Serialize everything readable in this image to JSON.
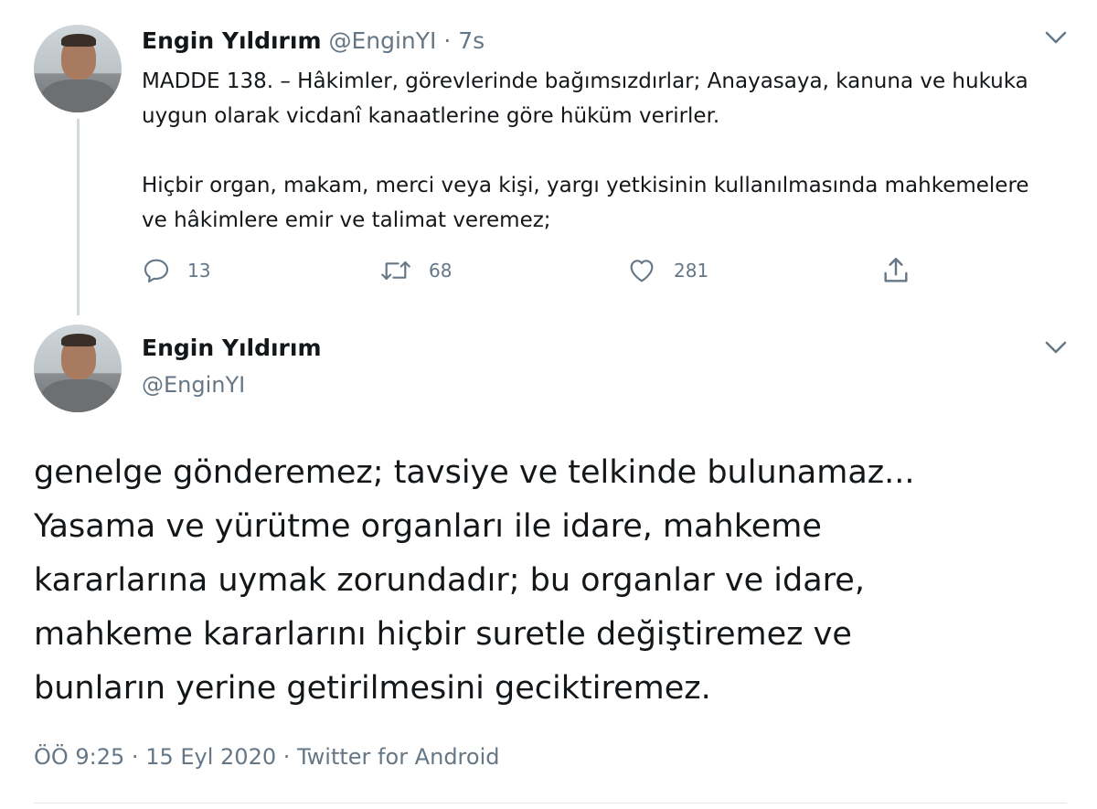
{
  "tweet1": {
    "name": "Engin Yıldırım",
    "handle": "@EnginYI",
    "separator": "·",
    "time": "7s",
    "paragraphs": [
      "MADDE 138. – Hâkimler, görevlerinde bağımsızdırlar; Anayasaya, kanuna ve hukuka uygun olarak vicdanî kanaatlerine göre hüküm verirler.",
      "Hiçbir organ, makam, merci veya kişi, yargı yetkisinin kullanılmasında mahkemelere ve hâkimlere emir ve talimat veremez;"
    ],
    "actions": {
      "reply_count": "13",
      "retweet_count": "68",
      "like_count": "281"
    }
  },
  "tweet2": {
    "name": "Engin Yıldırım",
    "handle": "@EnginYI",
    "lines": [
      "genelge gönderemez; tavsiye ve telkinde bulunamaz...",
      "Yasama ve yürütme organları ile idare, mahkeme",
      "kararlarına uymak zorundadır; bu organlar ve idare,",
      "mahkeme kararlarını hiçbir suretle değiştiremez ve",
      "bunların yerine getirilmesini geciktiremez."
    ],
    "meta": "ÖÖ 9:25 · 15 Eyl 2020 · Twitter for Android"
  },
  "icons": {
    "caret": "chevron-down-icon",
    "reply": "reply-icon",
    "retweet": "retweet-icon",
    "like": "heart-icon",
    "share": "share-icon"
  },
  "colors": {
    "text": "#14171a",
    "muted": "#657786",
    "thread_line": "#cfd9de"
  }
}
